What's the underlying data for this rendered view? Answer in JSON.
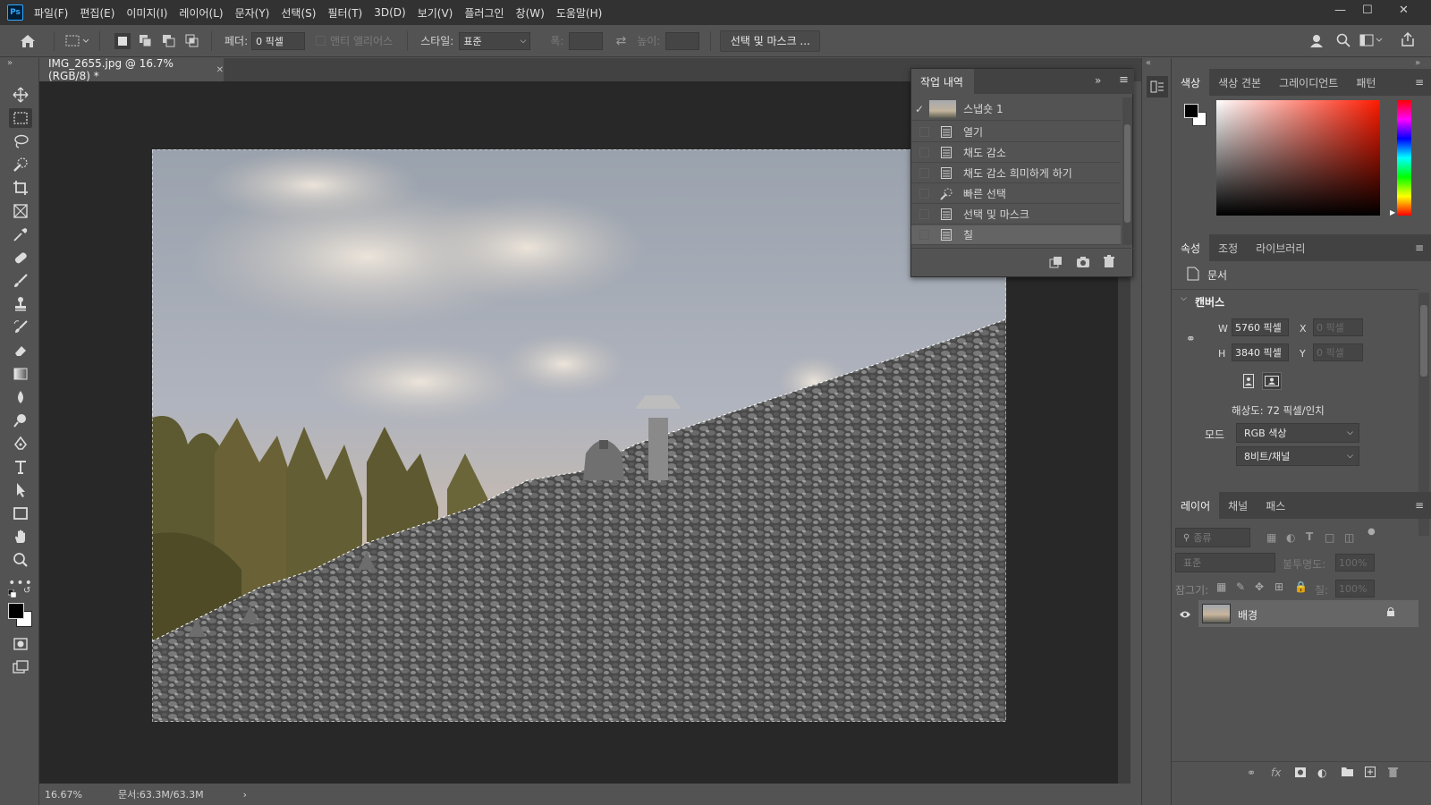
{
  "app": {
    "logo": "Ps"
  },
  "menubar": {
    "items": [
      "파일(F)",
      "편집(E)",
      "이미지(I)",
      "레이어(L)",
      "문자(Y)",
      "선택(S)",
      "필터(T)",
      "3D(D)",
      "보기(V)",
      "플러그인",
      "창(W)",
      "도움말(H)"
    ]
  },
  "options": {
    "feather_label": "페더:",
    "feather_value": "0 픽셀",
    "antialias_label": "앤티 앨리어스",
    "style_label": "스타일:",
    "style_value": "표준",
    "width_label": "폭:",
    "height_label": "높이:",
    "select_mask_button": "선택 및 마스크 ..."
  },
  "document": {
    "tab_title": "IMG_2655.jpg @ 16.7% (RGB/8) *",
    "zoom": "16.67%",
    "doc_size": "문서:63.3M/63.3M"
  },
  "history": {
    "title": "작업 내역",
    "snapshot": "스냅숏 1",
    "items": [
      "열기",
      "채도 감소",
      "채도 감소 희미하게 하기",
      "빠른 선택",
      "선택 및 마스크",
      "칠"
    ]
  },
  "color_panel": {
    "tabs": [
      "색상",
      "색상 견본",
      "그레이디언트",
      "패턴"
    ]
  },
  "properties": {
    "tabs": [
      "속성",
      "조정",
      "라이브러리"
    ],
    "doc_label": "문서",
    "canvas_label": "캔버스",
    "w_label": "W",
    "w_value": "5760 픽셀",
    "h_label": "H",
    "h_value": "3840 픽셀",
    "x_label": "X",
    "x_value": "0 픽셀",
    "y_label": "Y",
    "y_value": "0 픽셀",
    "resolution": "해상도: 72 픽셀/인치",
    "mode_label": "모드",
    "mode_value": "RGB 색상",
    "depth_value": "8비트/채널"
  },
  "layers": {
    "tabs": [
      "레이어",
      "채널",
      "패스"
    ],
    "filter_placeholder": "종류",
    "blend_mode": "표준",
    "opacity_label": "불투명도:",
    "opacity_value": "100%",
    "lock_label": "잠그기:",
    "fill_label": "칠:",
    "fill_value": "100%",
    "layer_name": "배경"
  }
}
